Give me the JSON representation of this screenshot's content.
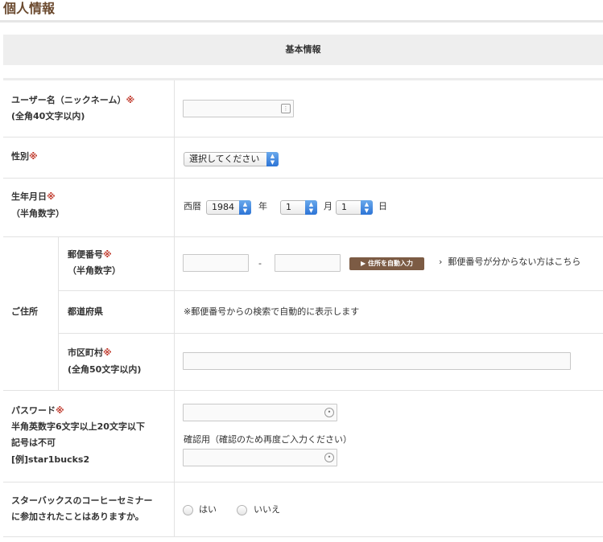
{
  "page": {
    "title": "個人情報"
  },
  "section": {
    "header": "基本情報"
  },
  "form": {
    "username": {
      "label": "ユーザー名（ニックネーム）",
      "required": "※",
      "note": "(全角40文字以内)",
      "value": ""
    },
    "gender": {
      "label": "性別",
      "required": "※",
      "select_value": "選択してください"
    },
    "birthdate": {
      "label": "生年月日",
      "required": "※",
      "note": "（半角数字）",
      "era_label": "西暦",
      "year_value": "1984",
      "year_unit": "年",
      "month_value": "1",
      "month_unit": "月",
      "day_value": "1",
      "day_unit": "日"
    },
    "address": {
      "group_label": "ご住所",
      "postal": {
        "label": "郵便番号",
        "required": "※",
        "note": "（半角数字）",
        "separator": "-",
        "auto_button": "住所を自動入力",
        "help_link": "郵便番号が分からない方はこちら"
      },
      "prefecture": {
        "label": "都道府県",
        "note": "※郵便番号からの検索で自動的に表示します"
      },
      "city": {
        "label": "市区町村",
        "required": "※",
        "note": "(全角50文字以内)"
      }
    },
    "password": {
      "label": "パスワード",
      "required": "※",
      "note1": "半角英数字6文字以上20文字以下",
      "note2": "記号は不可",
      "example": "[例]star1bucks2",
      "confirm_label": "確認用（確認のため再度ご入力ください）"
    },
    "seminar": {
      "label_line1": "スターバックスのコーヒーセミナー",
      "label_line2": "に参加されたことはありますか。",
      "option_yes": "はい",
      "option_no": "いいえ"
    }
  },
  "colors": {
    "title": "#6b4a2f",
    "required": "#c0392b",
    "button": "#7c5b44",
    "select_arrow": "#2c74d6"
  },
  "icons": {
    "username_field": "key-icon",
    "password_field": "lock-dot-icon",
    "chevron": "chevron-right-icon"
  }
}
